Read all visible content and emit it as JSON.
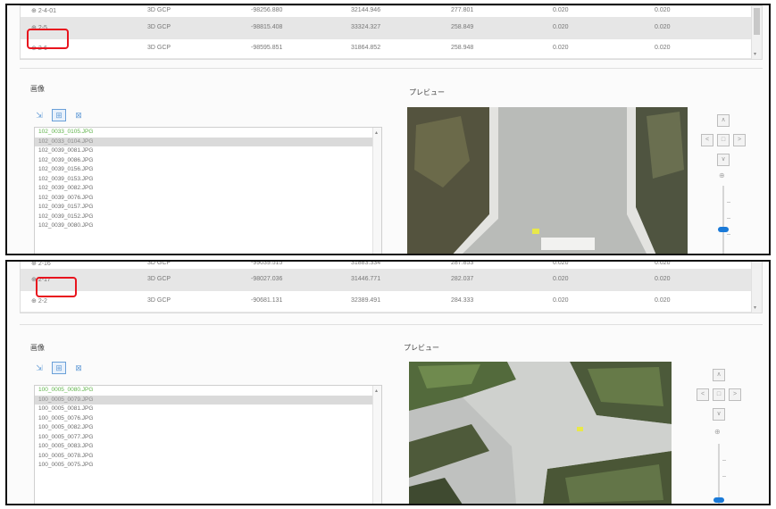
{
  "top": {
    "rows": [
      {
        "name": "2-4-01",
        "type": "3D GCP",
        "x": "-98256.880",
        "y": "32144.946",
        "z": "277.801",
        "a": "0.020",
        "b": "0.020",
        "selected": false
      },
      {
        "name": "2-5",
        "type": "3D GCP",
        "x": "-98815.408",
        "y": "33324.327",
        "z": "258.849",
        "a": "0.020",
        "b": "0.020",
        "selected": true
      },
      {
        "name": "2-6",
        "type": "3D GCP",
        "x": "-98595.851",
        "y": "31864.852",
        "z": "258.948",
        "a": "0.020",
        "b": "0.020",
        "selected": false
      }
    ],
    "images_label": "画像",
    "preview_label": "プレビュー",
    "files": [
      {
        "name": "102_0033_0105.JPG",
        "style": "green"
      },
      {
        "name": "102_0033_0104.JPG",
        "style": "sel"
      },
      {
        "name": "102_0039_0081.JPG",
        "style": ""
      },
      {
        "name": "102_0039_0086.JPG",
        "style": ""
      },
      {
        "name": "102_0039_0156.JPG",
        "style": ""
      },
      {
        "name": "102_0039_0153.JPG",
        "style": ""
      },
      {
        "name": "102_0039_0082.JPG",
        "style": ""
      },
      {
        "name": "102_0039_0076.JPG",
        "style": ""
      },
      {
        "name": "102_0039_0157.JPG",
        "style": ""
      },
      {
        "name": "102_0039_0152.JPG",
        "style": ""
      },
      {
        "name": "102_0039_0080.JPG",
        "style": ""
      }
    ]
  },
  "bottom": {
    "partial_row": {
      "name": "2-16",
      "type": "3D GCP",
      "x": "-99039.515",
      "y": "31883.334",
      "z": "287.853",
      "a": "0.020",
      "b": "0.020"
    },
    "rows": [
      {
        "name": "2-17",
        "type": "3D GCP",
        "x": "-98027.036",
        "y": "31446.771",
        "z": "282.037",
        "a": "0.020",
        "b": "0.020",
        "selected": true
      },
      {
        "name": "2-2",
        "type": "3D GCP",
        "x": "-90681.131",
        "y": "32389.491",
        "z": "284.333",
        "a": "0.020",
        "b": "0.020",
        "selected": false
      }
    ],
    "images_label": "画像",
    "preview_label": "プレビュー",
    "files": [
      {
        "name": "100_0005_0080.JPG",
        "style": "green"
      },
      {
        "name": "100_0005_0079.JPG",
        "style": "sel"
      },
      {
        "name": "100_0005_0081.JPG",
        "style": ""
      },
      {
        "name": "100_0005_0076.JPG",
        "style": ""
      },
      {
        "name": "100_0005_0082.JPG",
        "style": ""
      },
      {
        "name": "100_0005_0077.JPG",
        "style": ""
      },
      {
        "name": "100_0005_0083.JPG",
        "style": ""
      },
      {
        "name": "100_0005_0078.JPG",
        "style": ""
      },
      {
        "name": "100_0005_0075.JPG",
        "style": ""
      }
    ]
  },
  "toolbar": {
    "tool1": "⇲",
    "tool2": "⊞",
    "tool3": "⊠"
  },
  "nav": {
    "up": "∧",
    "down": "∨",
    "left": "<",
    "right": ">",
    "center": "□",
    "zoom": "⊕"
  },
  "colors": {
    "highlight": "#e8141e",
    "accent": "#1a7ad8",
    "green_text": "#5fb34a"
  }
}
